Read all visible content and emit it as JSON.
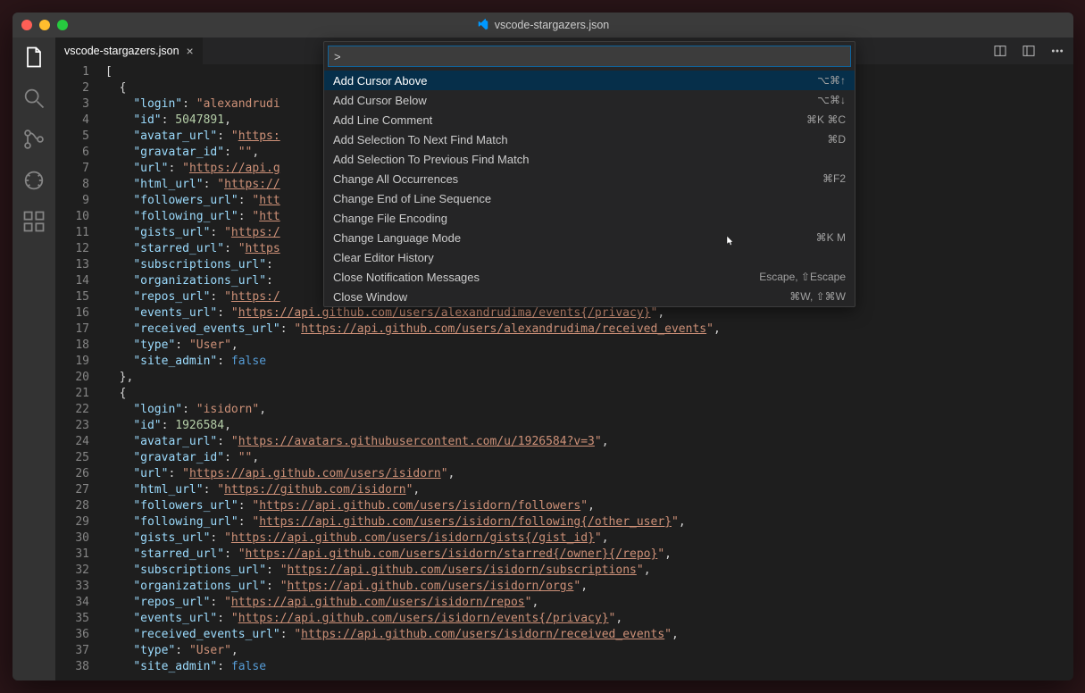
{
  "window_title": "vscode-stargazers.json",
  "tab": {
    "label": "vscode-stargazers.json"
  },
  "palette": {
    "input": ">",
    "items": [
      {
        "label": "Add Cursor Above",
        "shortcut": "⌥⌘↑"
      },
      {
        "label": "Add Cursor Below",
        "shortcut": "⌥⌘↓"
      },
      {
        "label": "Add Line Comment",
        "shortcut": "⌘K ⌘C"
      },
      {
        "label": "Add Selection To Next Find Match",
        "shortcut": "⌘D"
      },
      {
        "label": "Add Selection To Previous Find Match",
        "shortcut": ""
      },
      {
        "label": "Change All Occurrences",
        "shortcut": "⌘F2"
      },
      {
        "label": "Change End of Line Sequence",
        "shortcut": ""
      },
      {
        "label": "Change File Encoding",
        "shortcut": ""
      },
      {
        "label": "Change Language Mode",
        "shortcut": "⌘K M"
      },
      {
        "label": "Clear Editor History",
        "shortcut": ""
      },
      {
        "label": "Close Notification Messages",
        "shortcut": "Escape, ⇧Escape"
      },
      {
        "label": "Close Window",
        "shortcut": "⌘W, ⇧⌘W"
      }
    ]
  },
  "code_lines": [
    [
      {
        "t": "punc",
        "v": "["
      }
    ],
    [
      {
        "t": "punc",
        "v": "  {"
      }
    ],
    [
      {
        "t": "punc",
        "v": "    "
      },
      {
        "t": "key",
        "v": "\"login\""
      },
      {
        "t": "punc",
        "v": ": "
      },
      {
        "t": "str",
        "v": "\"alexandrudi"
      }
    ],
    [
      {
        "t": "punc",
        "v": "    "
      },
      {
        "t": "key",
        "v": "\"id\""
      },
      {
        "t": "punc",
        "v": ": "
      },
      {
        "t": "num",
        "v": "5047891"
      },
      {
        "t": "punc",
        "v": ","
      }
    ],
    [
      {
        "t": "punc",
        "v": "    "
      },
      {
        "t": "key",
        "v": "\"avatar_url\""
      },
      {
        "t": "punc",
        "v": ": "
      },
      {
        "t": "str",
        "v": "\""
      },
      {
        "t": "url",
        "v": "https:"
      }
    ],
    [
      {
        "t": "punc",
        "v": "    "
      },
      {
        "t": "key",
        "v": "\"gravatar_id\""
      },
      {
        "t": "punc",
        "v": ": "
      },
      {
        "t": "str",
        "v": "\"\""
      },
      {
        "t": "punc",
        "v": ","
      }
    ],
    [
      {
        "t": "punc",
        "v": "    "
      },
      {
        "t": "key",
        "v": "\"url\""
      },
      {
        "t": "punc",
        "v": ": "
      },
      {
        "t": "str",
        "v": "\""
      },
      {
        "t": "url",
        "v": "https://api.g"
      }
    ],
    [
      {
        "t": "punc",
        "v": "    "
      },
      {
        "t": "key",
        "v": "\"html_url\""
      },
      {
        "t": "punc",
        "v": ": "
      },
      {
        "t": "str",
        "v": "\""
      },
      {
        "t": "url",
        "v": "https://"
      }
    ],
    [
      {
        "t": "punc",
        "v": "    "
      },
      {
        "t": "key",
        "v": "\"followers_url\""
      },
      {
        "t": "punc",
        "v": ": "
      },
      {
        "t": "str",
        "v": "\""
      },
      {
        "t": "url",
        "v": "htt"
      }
    ],
    [
      {
        "t": "punc",
        "v": "    "
      },
      {
        "t": "key",
        "v": "\"following_url\""
      },
      {
        "t": "punc",
        "v": ": "
      },
      {
        "t": "str",
        "v": "\""
      },
      {
        "t": "url",
        "v": "htt"
      }
    ],
    [
      {
        "t": "punc",
        "v": "    "
      },
      {
        "t": "key",
        "v": "\"gists_url\""
      },
      {
        "t": "punc",
        "v": ": "
      },
      {
        "t": "str",
        "v": "\""
      },
      {
        "t": "url",
        "v": "https:/"
      }
    ],
    [
      {
        "t": "punc",
        "v": "    "
      },
      {
        "t": "key",
        "v": "\"starred_url\""
      },
      {
        "t": "punc",
        "v": ": "
      },
      {
        "t": "str",
        "v": "\""
      },
      {
        "t": "url",
        "v": "https"
      }
    ],
    [
      {
        "t": "punc",
        "v": "    "
      },
      {
        "t": "key",
        "v": "\"subscriptions_url\""
      },
      {
        "t": "punc",
        "v": ":"
      }
    ],
    [
      {
        "t": "punc",
        "v": "    "
      },
      {
        "t": "key",
        "v": "\"organizations_url\""
      },
      {
        "t": "punc",
        "v": ":"
      }
    ],
    [
      {
        "t": "punc",
        "v": "    "
      },
      {
        "t": "key",
        "v": "\"repos_url\""
      },
      {
        "t": "punc",
        "v": ": "
      },
      {
        "t": "str",
        "v": "\""
      },
      {
        "t": "url",
        "v": "https:/"
      }
    ],
    [
      {
        "t": "punc",
        "v": "    "
      },
      {
        "t": "key",
        "v": "\"events_url\""
      },
      {
        "t": "punc",
        "v": ": "
      },
      {
        "t": "str",
        "v": "\""
      },
      {
        "t": "url",
        "v": "https://api.github.com/users/alexandrudima/events{/privacy}"
      },
      {
        "t": "str",
        "v": "\""
      },
      {
        "t": "punc",
        "v": ","
      }
    ],
    [
      {
        "t": "punc",
        "v": "    "
      },
      {
        "t": "key",
        "v": "\"received_events_url\""
      },
      {
        "t": "punc",
        "v": ": "
      },
      {
        "t": "str",
        "v": "\""
      },
      {
        "t": "url",
        "v": "https://api.github.com/users/alexandrudima/received_events"
      },
      {
        "t": "str",
        "v": "\""
      },
      {
        "t": "punc",
        "v": ","
      }
    ],
    [
      {
        "t": "punc",
        "v": "    "
      },
      {
        "t": "key",
        "v": "\"type\""
      },
      {
        "t": "punc",
        "v": ": "
      },
      {
        "t": "str",
        "v": "\"User\""
      },
      {
        "t": "punc",
        "v": ","
      }
    ],
    [
      {
        "t": "punc",
        "v": "    "
      },
      {
        "t": "key",
        "v": "\"site_admin\""
      },
      {
        "t": "punc",
        "v": ": "
      },
      {
        "t": "const",
        "v": "false"
      }
    ],
    [
      {
        "t": "punc",
        "v": "  },"
      }
    ],
    [
      {
        "t": "punc",
        "v": "  {"
      }
    ],
    [
      {
        "t": "punc",
        "v": "    "
      },
      {
        "t": "key",
        "v": "\"login\""
      },
      {
        "t": "punc",
        "v": ": "
      },
      {
        "t": "str",
        "v": "\"isidorn\""
      },
      {
        "t": "punc",
        "v": ","
      }
    ],
    [
      {
        "t": "punc",
        "v": "    "
      },
      {
        "t": "key",
        "v": "\"id\""
      },
      {
        "t": "punc",
        "v": ": "
      },
      {
        "t": "num",
        "v": "1926584"
      },
      {
        "t": "punc",
        "v": ","
      }
    ],
    [
      {
        "t": "punc",
        "v": "    "
      },
      {
        "t": "key",
        "v": "\"avatar_url\""
      },
      {
        "t": "punc",
        "v": ": "
      },
      {
        "t": "str",
        "v": "\""
      },
      {
        "t": "url",
        "v": "https://avatars.githubusercontent.com/u/1926584?v=3"
      },
      {
        "t": "str",
        "v": "\""
      },
      {
        "t": "punc",
        "v": ","
      }
    ],
    [
      {
        "t": "punc",
        "v": "    "
      },
      {
        "t": "key",
        "v": "\"gravatar_id\""
      },
      {
        "t": "punc",
        "v": ": "
      },
      {
        "t": "str",
        "v": "\"\""
      },
      {
        "t": "punc",
        "v": ","
      }
    ],
    [
      {
        "t": "punc",
        "v": "    "
      },
      {
        "t": "key",
        "v": "\"url\""
      },
      {
        "t": "punc",
        "v": ": "
      },
      {
        "t": "str",
        "v": "\""
      },
      {
        "t": "url",
        "v": "https://api.github.com/users/isidorn"
      },
      {
        "t": "str",
        "v": "\""
      },
      {
        "t": "punc",
        "v": ","
      }
    ],
    [
      {
        "t": "punc",
        "v": "    "
      },
      {
        "t": "key",
        "v": "\"html_url\""
      },
      {
        "t": "punc",
        "v": ": "
      },
      {
        "t": "str",
        "v": "\""
      },
      {
        "t": "url",
        "v": "https://github.com/isidorn"
      },
      {
        "t": "str",
        "v": "\""
      },
      {
        "t": "punc",
        "v": ","
      }
    ],
    [
      {
        "t": "punc",
        "v": "    "
      },
      {
        "t": "key",
        "v": "\"followers_url\""
      },
      {
        "t": "punc",
        "v": ": "
      },
      {
        "t": "str",
        "v": "\""
      },
      {
        "t": "url",
        "v": "https://api.github.com/users/isidorn/followers"
      },
      {
        "t": "str",
        "v": "\""
      },
      {
        "t": "punc",
        "v": ","
      }
    ],
    [
      {
        "t": "punc",
        "v": "    "
      },
      {
        "t": "key",
        "v": "\"following_url\""
      },
      {
        "t": "punc",
        "v": ": "
      },
      {
        "t": "str",
        "v": "\""
      },
      {
        "t": "url",
        "v": "https://api.github.com/users/isidorn/following{/other_user}"
      },
      {
        "t": "str",
        "v": "\""
      },
      {
        "t": "punc",
        "v": ","
      }
    ],
    [
      {
        "t": "punc",
        "v": "    "
      },
      {
        "t": "key",
        "v": "\"gists_url\""
      },
      {
        "t": "punc",
        "v": ": "
      },
      {
        "t": "str",
        "v": "\""
      },
      {
        "t": "url",
        "v": "https://api.github.com/users/isidorn/gists{/gist_id}"
      },
      {
        "t": "str",
        "v": "\""
      },
      {
        "t": "punc",
        "v": ","
      }
    ],
    [
      {
        "t": "punc",
        "v": "    "
      },
      {
        "t": "key",
        "v": "\"starred_url\""
      },
      {
        "t": "punc",
        "v": ": "
      },
      {
        "t": "str",
        "v": "\""
      },
      {
        "t": "url",
        "v": "https://api.github.com/users/isidorn/starred{/owner}{/repo}"
      },
      {
        "t": "str",
        "v": "\""
      },
      {
        "t": "punc",
        "v": ","
      }
    ],
    [
      {
        "t": "punc",
        "v": "    "
      },
      {
        "t": "key",
        "v": "\"subscriptions_url\""
      },
      {
        "t": "punc",
        "v": ": "
      },
      {
        "t": "str",
        "v": "\""
      },
      {
        "t": "url",
        "v": "https://api.github.com/users/isidorn/subscriptions"
      },
      {
        "t": "str",
        "v": "\""
      },
      {
        "t": "punc",
        "v": ","
      }
    ],
    [
      {
        "t": "punc",
        "v": "    "
      },
      {
        "t": "key",
        "v": "\"organizations_url\""
      },
      {
        "t": "punc",
        "v": ": "
      },
      {
        "t": "str",
        "v": "\""
      },
      {
        "t": "url",
        "v": "https://api.github.com/users/isidorn/orgs"
      },
      {
        "t": "str",
        "v": "\""
      },
      {
        "t": "punc",
        "v": ","
      }
    ],
    [
      {
        "t": "punc",
        "v": "    "
      },
      {
        "t": "key",
        "v": "\"repos_url\""
      },
      {
        "t": "punc",
        "v": ": "
      },
      {
        "t": "str",
        "v": "\""
      },
      {
        "t": "url",
        "v": "https://api.github.com/users/isidorn/repos"
      },
      {
        "t": "str",
        "v": "\""
      },
      {
        "t": "punc",
        "v": ","
      }
    ],
    [
      {
        "t": "punc",
        "v": "    "
      },
      {
        "t": "key",
        "v": "\"events_url\""
      },
      {
        "t": "punc",
        "v": ": "
      },
      {
        "t": "str",
        "v": "\""
      },
      {
        "t": "url",
        "v": "https://api.github.com/users/isidorn/events{/privacy}"
      },
      {
        "t": "str",
        "v": "\""
      },
      {
        "t": "punc",
        "v": ","
      }
    ],
    [
      {
        "t": "punc",
        "v": "    "
      },
      {
        "t": "key",
        "v": "\"received_events_url\""
      },
      {
        "t": "punc",
        "v": ": "
      },
      {
        "t": "str",
        "v": "\""
      },
      {
        "t": "url",
        "v": "https://api.github.com/users/isidorn/received_events"
      },
      {
        "t": "str",
        "v": "\""
      },
      {
        "t": "punc",
        "v": ","
      }
    ],
    [
      {
        "t": "punc",
        "v": "    "
      },
      {
        "t": "key",
        "v": "\"type\""
      },
      {
        "t": "punc",
        "v": ": "
      },
      {
        "t": "str",
        "v": "\"User\""
      },
      {
        "t": "punc",
        "v": ","
      }
    ],
    [
      {
        "t": "punc",
        "v": "    "
      },
      {
        "t": "key",
        "v": "\"site_admin\""
      },
      {
        "t": "punc",
        "v": ": "
      },
      {
        "t": "const",
        "v": "false"
      }
    ]
  ]
}
